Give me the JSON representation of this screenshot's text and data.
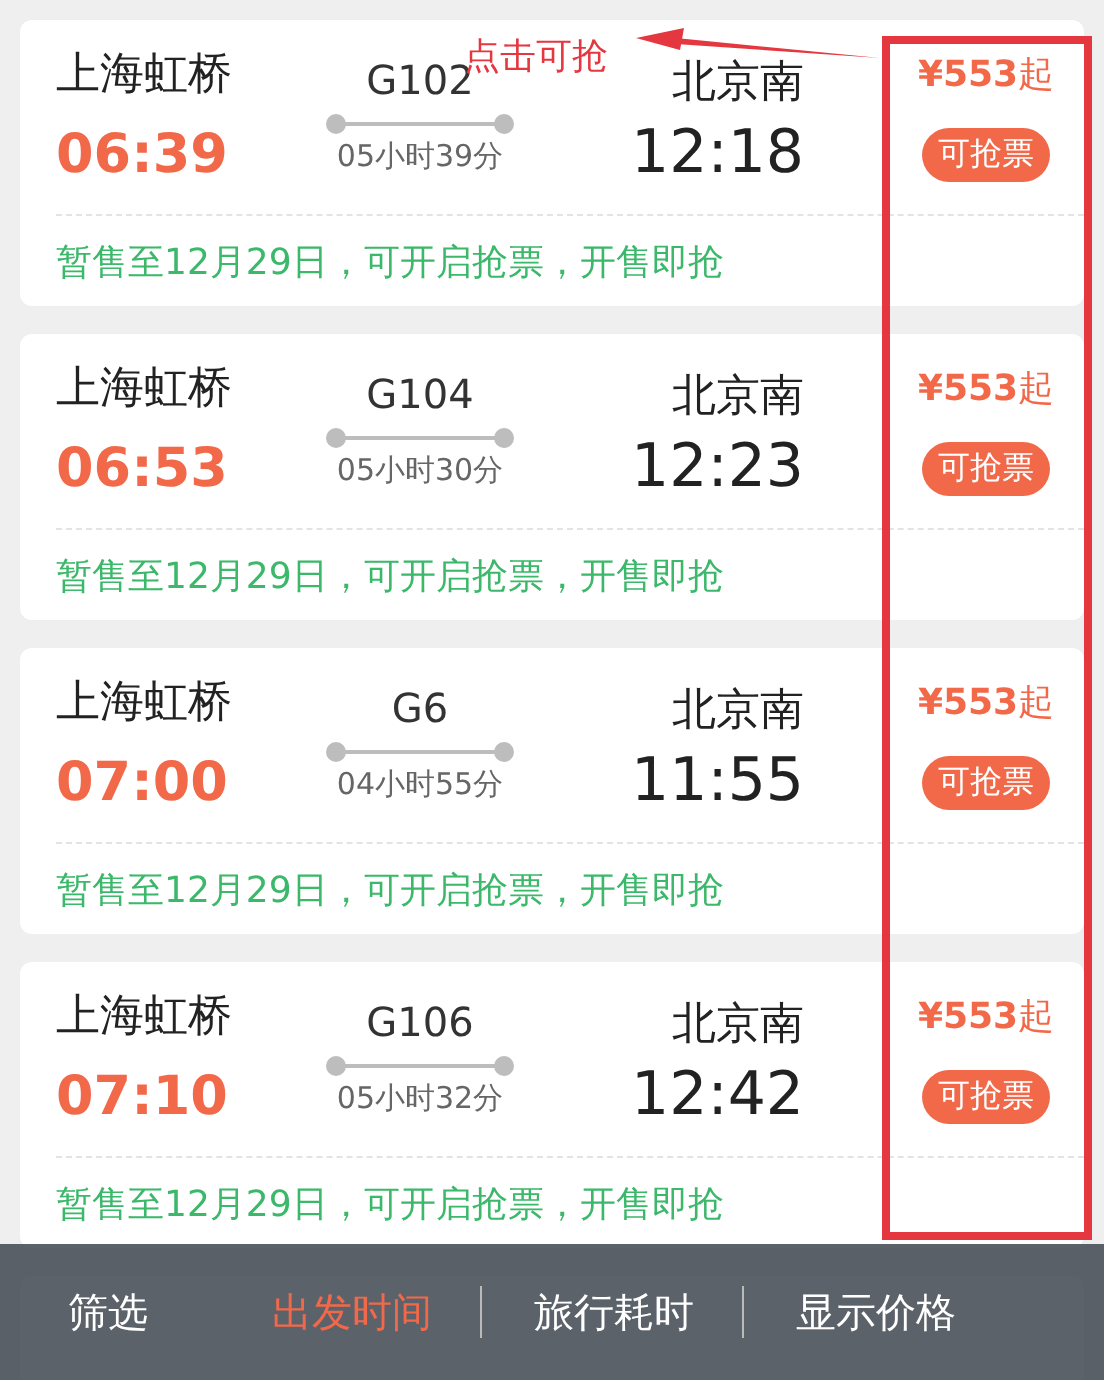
{
  "annotation": {
    "label": "点击可抢"
  },
  "trains": [
    {
      "from": "上海虹桥",
      "train": "G102",
      "to": "北京南",
      "depart": "06:39",
      "duration": "05小时39分",
      "arrive": "12:18",
      "price": "**¥553**起",
      "badge": "可抢票",
      "note": "暂售至12月29日，可开启抢票，开售即抢"
    },
    {
      "from": "上海虹桥",
      "train": "G104",
      "to": "北京南",
      "depart": "06:53",
      "duration": "05小时30分",
      "arrive": "12:23",
      "price": "**¥553**起",
      "badge": "可抢票",
      "note": "暂售至12月29日，可开启抢票，开售即抢"
    },
    {
      "from": "上海虹桥",
      "train": "G6",
      "to": "北京南",
      "depart": "07:00",
      "duration": "04小时55分",
      "arrive": "11:55",
      "price": "**¥553**起",
      "badge": "可抢票",
      "note": "暂售至12月29日，可开启抢票，开售即抢"
    },
    {
      "from": "上海虹桥",
      "train": "G106",
      "to": "北京南",
      "depart": "07:10",
      "duration": "05小时32分",
      "arrive": "12:42",
      "price": "**¥553**起",
      "badge": "可抢票",
      "note": "暂售至12月29日，可开启抢票，开售即抢"
    }
  ],
  "bottom_bar": {
    "tabs": [
      {
        "label": "筛选",
        "selected": false
      },
      {
        "label": "出发时间",
        "selected": true
      },
      {
        "label": "旅行耗时",
        "selected": false
      },
      {
        "label": "显示价格",
        "selected": false
      }
    ]
  }
}
